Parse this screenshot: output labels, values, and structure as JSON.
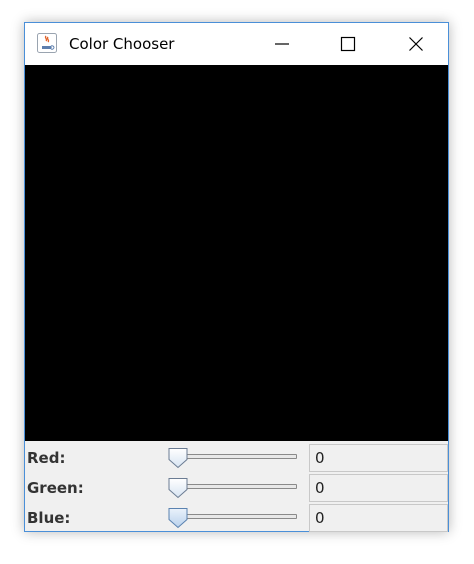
{
  "window": {
    "title": "Color Chooser",
    "icon": "java-cup-icon",
    "accent_border": "#4a8fd8"
  },
  "preview": {
    "color": "#000000"
  },
  "controls": [
    {
      "label": "Red:",
      "value": "0",
      "slider_fraction": 0
    },
    {
      "label": "Green:",
      "value": "0",
      "slider_fraction": 0
    },
    {
      "label": "Blue:",
      "value": "0",
      "slider_fraction": 0
    }
  ]
}
